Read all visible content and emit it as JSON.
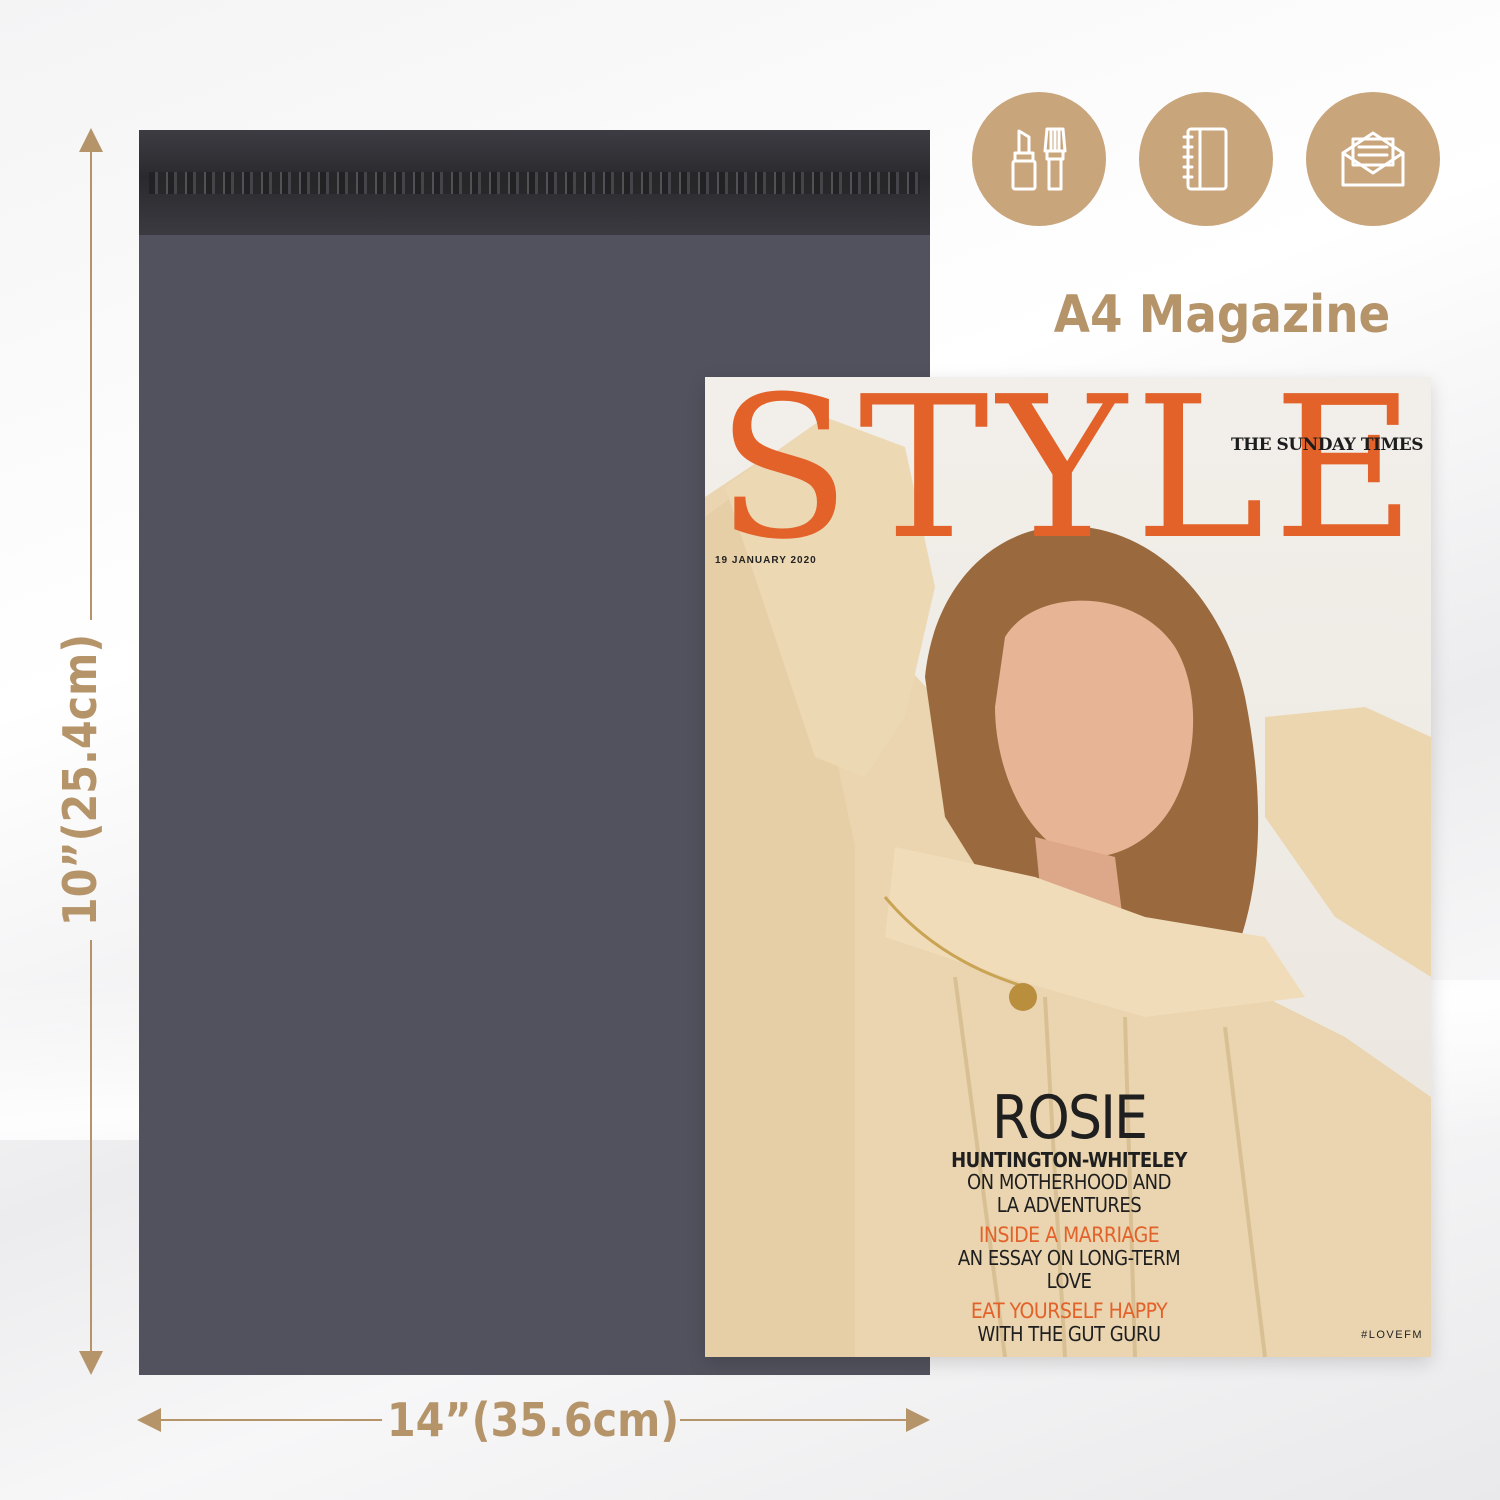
{
  "dimensions": {
    "height_label": "10”(25.4cm)",
    "width_label": "14”(35.6cm)",
    "accent_color": "#b5946a"
  },
  "mailer": {
    "color": "#52525e"
  },
  "icons": [
    {
      "name": "lipstick-brush-icon"
    },
    {
      "name": "notebook-icon"
    },
    {
      "name": "envelope-letter-icon"
    }
  ],
  "a4_label": "A4 Magazine",
  "magazine": {
    "title": "STYLE",
    "brand": "THE SUNDAY TIMES",
    "date": "19 JANUARY 2020",
    "title_color": "#e2622a",
    "coverlines": {
      "name": "ROSIE",
      "subname": "HUNTINGTON-WHITELEY",
      "line1": "ON MOTHERHOOD AND",
      "line2": "LA ADVENTURES",
      "highlight1": "INSIDE A MARRIAGE",
      "line3": "AN ESSAY ON LONG-TERM LOVE",
      "highlight2": "EAT YOURSELF HAPPY",
      "line4": "WITH THE GUT GURU"
    },
    "hashtag": "#LOVEFM"
  }
}
